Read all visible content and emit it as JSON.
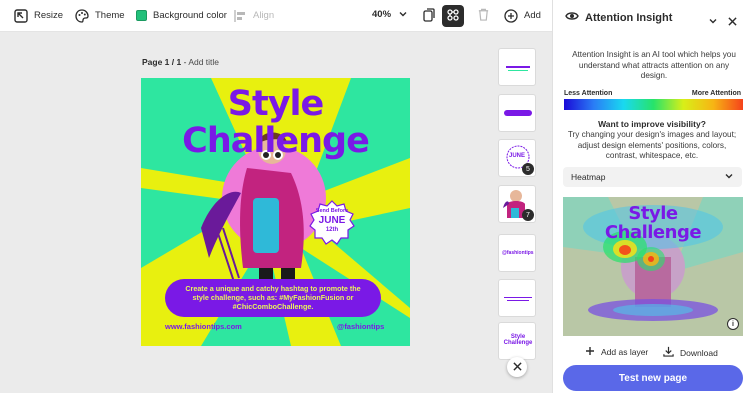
{
  "toolbar": {
    "resize_label": "Resize",
    "theme_label": "Theme",
    "background_label": "Background color",
    "background_color": "#22c07a",
    "align_label": "Align",
    "zoom": "40%",
    "add_label": "Add"
  },
  "canvas": {
    "page_label": "Page 1 / 1",
    "add_title": "Add title",
    "poster": {
      "headline_1": "Style",
      "headline_2": "Challenge",
      "badge_small": "Send Before",
      "badge_month": "JUNE",
      "badge_day": "12th",
      "promo_text": "Create a unique and catchy hashtag to promote the style challenge, such as: #MyFashionFusion or #ChicComboChallenge.",
      "website": "www.fashiontips.com",
      "handle": "@fashiontips"
    },
    "thumbnails": [
      {
        "name": "thumbnail-1"
      },
      {
        "name": "thumbnail-2"
      },
      {
        "name": "thumbnail-3",
        "badge": "5",
        "text": "JUNE"
      },
      {
        "name": "thumbnail-4",
        "badge": "7"
      },
      {
        "name": "thumbnail-5",
        "text": "@fashiontips"
      },
      {
        "name": "thumbnail-6"
      },
      {
        "name": "thumbnail-7",
        "text": "Style Challenge"
      }
    ]
  },
  "panel": {
    "title": "Attention Insight",
    "description": "Attention Insight is an AI tool which helps you understand what attracts attention on any design.",
    "less_label": "Less Attention",
    "more_label": "More Attention",
    "improve_title": "Want to improve visibility?",
    "improve_body": "Try changing your design's images and layout; adjust design elements' positions, colors, contrast, whitespace, etc.",
    "view_select": "Heatmap",
    "heatmap_title_1": "Style",
    "heatmap_title_2": "Challenge",
    "add_layer_label": "Add as layer",
    "download_label": "Download",
    "cta_label": "Test new page"
  },
  "colors": {
    "brand_purple": "#7a19e6",
    "poster_yellow": "#e8f00f",
    "poster_green": "#2ee6a0",
    "cta_blue": "#5a68e8"
  }
}
